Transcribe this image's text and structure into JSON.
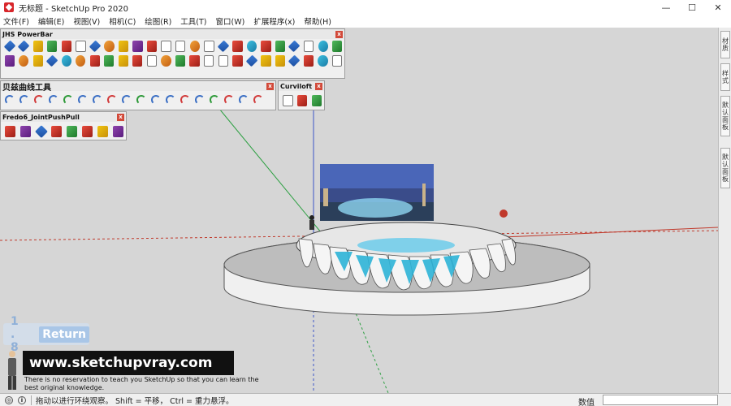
{
  "window": {
    "title": "无标题 - SketchUp Pro 2020",
    "minimize": "—",
    "maximize": "☐",
    "close": "✕"
  },
  "menu": [
    "文件(F)",
    "编辑(E)",
    "视图(V)",
    "相机(C)",
    "绘图(R)",
    "工具(T)",
    "窗口(W)",
    "扩展程序(x)",
    "帮助(H)"
  ],
  "toolbars": {
    "jhs": {
      "title": "JHS PowerBar",
      "close": "x"
    },
    "bezier": {
      "title": "贝兹曲线工具",
      "close": "x"
    },
    "curviloft": {
      "title": "Curviloft",
      "close": "x"
    },
    "fredo": {
      "title": "Fredo6_JointPushPull",
      "close": "x"
    }
  },
  "tray": {
    "tabs": [
      "材质",
      "样式",
      "默认面板",
      "默认面板"
    ]
  },
  "overlay": {
    "counter": "1 . 8",
    "return_label": "Return",
    "watermark": "www.sketchupvray.com",
    "tagline": "There is no reservation to teach you SketchUp so that you can learn the best original knowledge."
  },
  "statusbar": {
    "hint": "拖动以进行环绕观察。 Shift = 平移， Ctrl = 重力悬浮。",
    "measurements_label": "数值",
    "measurements_value": ""
  },
  "colors": {
    "viewport_bg": "#d6d6d6",
    "axis_red": "#c0392b",
    "axis_green": "#2ea043",
    "axis_blue": "#3c55c8",
    "platform": "#ececec",
    "glass": "#2eb4d8"
  }
}
